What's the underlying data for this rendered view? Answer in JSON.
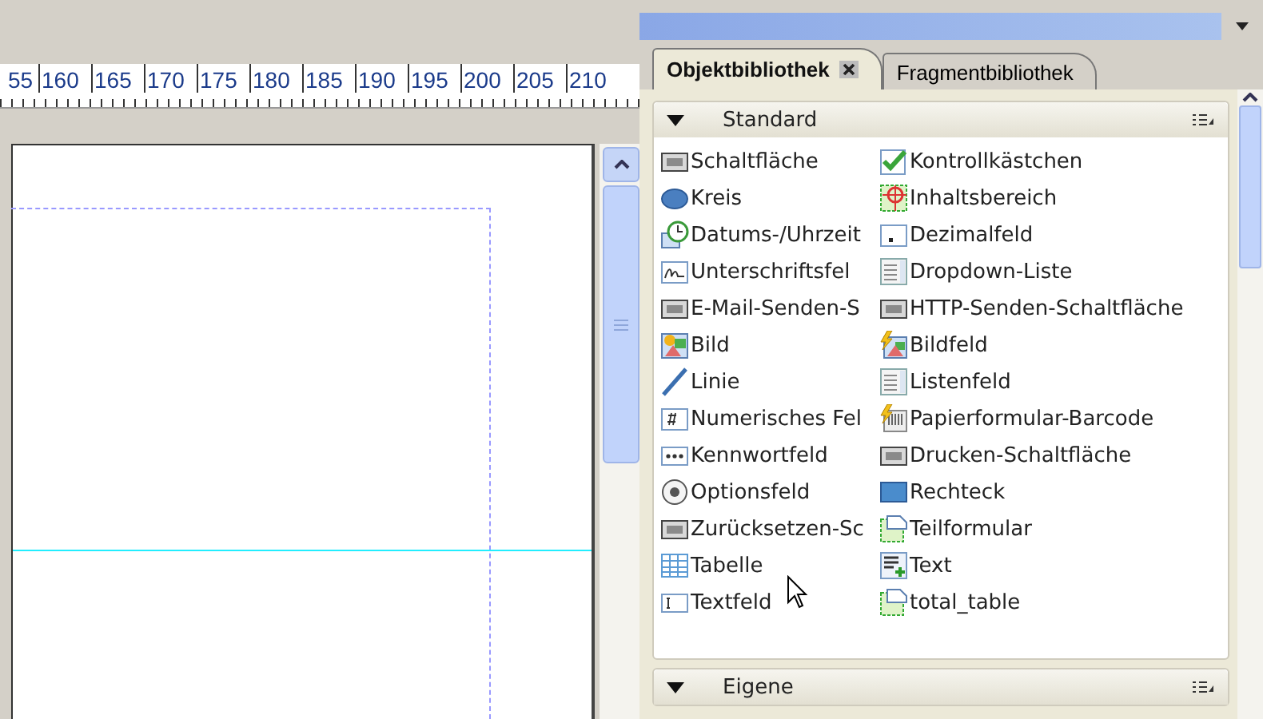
{
  "ruler": {
    "labels": [
      "55",
      "160",
      "165",
      "170",
      "175",
      "180",
      "185",
      "190",
      "195",
      "200",
      "205",
      "210"
    ]
  },
  "library": {
    "tabs": [
      {
        "label": "Objektbibliothek",
        "selected": true,
        "closable": true
      },
      {
        "label": "Fragmentbibliothek",
        "selected": false,
        "closable": false
      }
    ],
    "sections": [
      {
        "title": "Standard",
        "expanded": true,
        "items": [
          {
            "label": "Schaltfläche",
            "kind": "button"
          },
          {
            "label": "Kontrollkästchen",
            "kind": "checkbox"
          },
          {
            "label": "Kreis",
            "kind": "circle"
          },
          {
            "label": "Inhaltsbereich",
            "kind": "area"
          },
          {
            "label": "Datums-/Uhrzeit",
            "kind": "datetime"
          },
          {
            "label": "Dezimalfeld",
            "kind": "decimal"
          },
          {
            "label": "Unterschriftsfel",
            "kind": "signature"
          },
          {
            "label": "Dropdown-Liste",
            "kind": "dropdown"
          },
          {
            "label": "E-Mail-Senden-S",
            "kind": "button"
          },
          {
            "label": "HTTP-Senden-Schaltfläche",
            "kind": "button"
          },
          {
            "label": "Bild",
            "kind": "image"
          },
          {
            "label": "Bildfeld",
            "kind": "imagefield"
          },
          {
            "label": "Linie",
            "kind": "line"
          },
          {
            "label": "Listenfeld",
            "kind": "listbox"
          },
          {
            "label": "Numerisches Fel",
            "kind": "numeric"
          },
          {
            "label": "Papierformular-Barcode",
            "kind": "barcode"
          },
          {
            "label": "Kennwortfeld",
            "kind": "password"
          },
          {
            "label": "Drucken-Schaltfläche",
            "kind": "button"
          },
          {
            "label": "Optionsfeld",
            "kind": "radio"
          },
          {
            "label": "Rechteck",
            "kind": "rectangle"
          },
          {
            "label": "Zurücksetzen-Sc",
            "kind": "button"
          },
          {
            "label": "Teilformular",
            "kind": "subform"
          },
          {
            "label": "Tabelle",
            "kind": "table"
          },
          {
            "label": "Text",
            "kind": "text"
          },
          {
            "label": "Textfeld",
            "kind": "textfield"
          },
          {
            "label": "total_table",
            "kind": "subform"
          }
        ]
      },
      {
        "title": "Eigene",
        "expanded": true
      }
    ]
  }
}
